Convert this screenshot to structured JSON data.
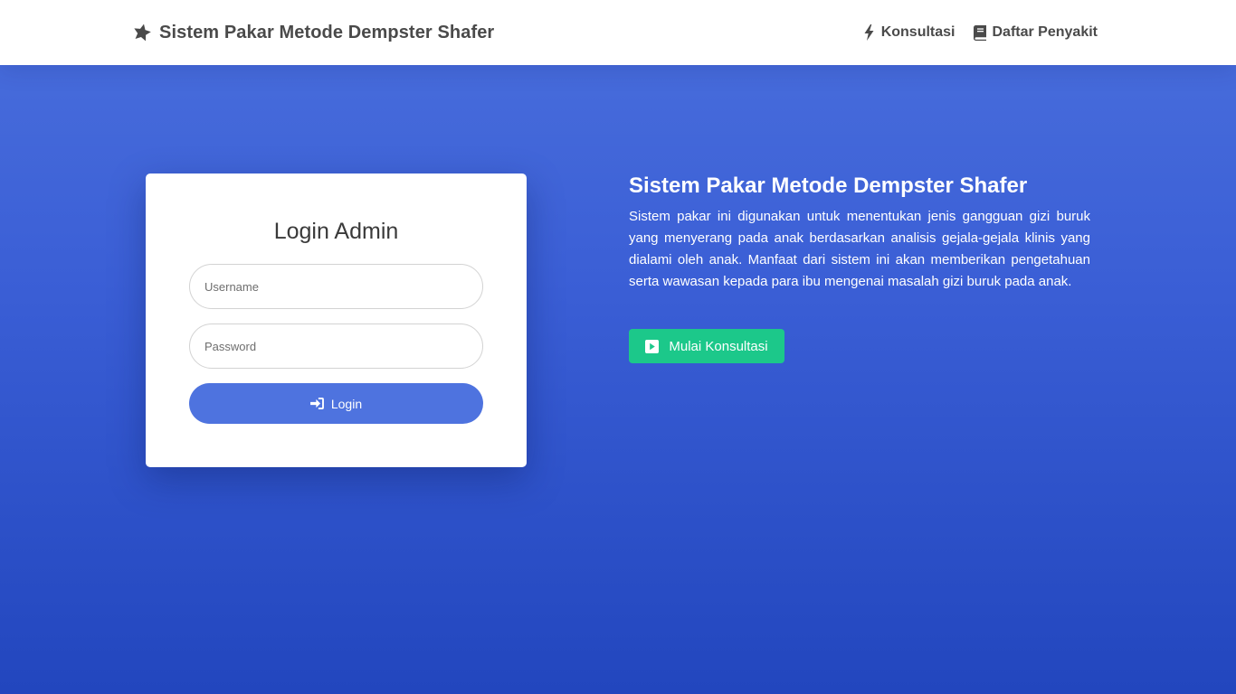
{
  "navbar": {
    "brand": "Sistem Pakar Metode Dempster Shafer",
    "brand_icon": "star-icon",
    "links": [
      {
        "label": "Konsultasi",
        "icon": "bolt-icon"
      },
      {
        "label": "Daftar Penyakit",
        "icon": "book-icon"
      }
    ]
  },
  "login": {
    "title": "Login Admin",
    "username_placeholder": "Username",
    "username_value": "",
    "password_placeholder": "Password",
    "password_value": "",
    "button_label": "Login",
    "button_icon": "sign-in-icon"
  },
  "hero": {
    "title": "Sistem Pakar Metode Dempster Shafer",
    "description": "Sistem pakar ini digunakan untuk menentukan jenis gangguan gizi buruk yang menyerang pada anak berdasarkan analisis gejala-gejala klinis yang dialami oleh anak. Manfaat dari sistem ini akan memberikan pengetahuan serta wawasan kepada para ibu mengenai masalah gizi buruk pada anak.",
    "button_label": "Mulai Konsultasi",
    "button_icon": "play-square-icon"
  },
  "colors": {
    "primary": "#4e73df",
    "success": "#1cc88a",
    "navbar_bg": "#ffffff",
    "text_dark": "#4a4a4a"
  }
}
